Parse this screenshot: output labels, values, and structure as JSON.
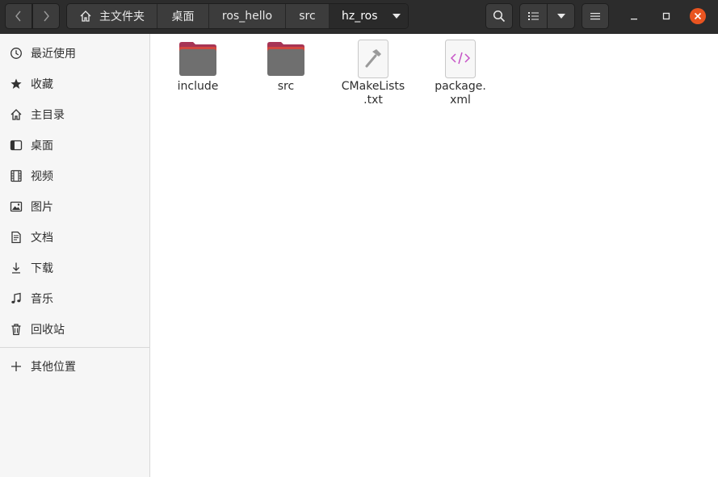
{
  "colors": {
    "headerbar": "#2c2c2c",
    "close_button": "#e95420",
    "folder_tab": "#b23b58",
    "folder_body": "#6f6f6f",
    "xml_icon": "#c754c7",
    "sidebar_bg": "#f6f6f6"
  },
  "path": [
    "主文件夹",
    "桌面",
    "ros_hello",
    "src",
    "hz_ros"
  ],
  "sidebar": {
    "items": [
      {
        "label": "最近使用",
        "icon": "clock-icon"
      },
      {
        "label": "收藏",
        "icon": "star-icon"
      },
      {
        "label": "主目录",
        "icon": "home-icon"
      },
      {
        "label": "桌面",
        "icon": "desktop-icon"
      },
      {
        "label": "视频",
        "icon": "film-icon"
      },
      {
        "label": "图片",
        "icon": "picture-icon"
      },
      {
        "label": "文档",
        "icon": "document-icon"
      },
      {
        "label": "下载",
        "icon": "download-icon"
      },
      {
        "label": "音乐",
        "icon": "music-icon"
      },
      {
        "label": "回收站",
        "icon": "trash-icon"
      }
    ],
    "other": {
      "label": "其他位置",
      "icon": "plus-icon"
    }
  },
  "files": [
    {
      "name": "include",
      "type": "folder"
    },
    {
      "name": "src",
      "type": "folder"
    },
    {
      "name": "CMakeLists\n.txt",
      "type": "text-file"
    },
    {
      "name": "package.\nxml",
      "type": "xml-file"
    }
  ]
}
